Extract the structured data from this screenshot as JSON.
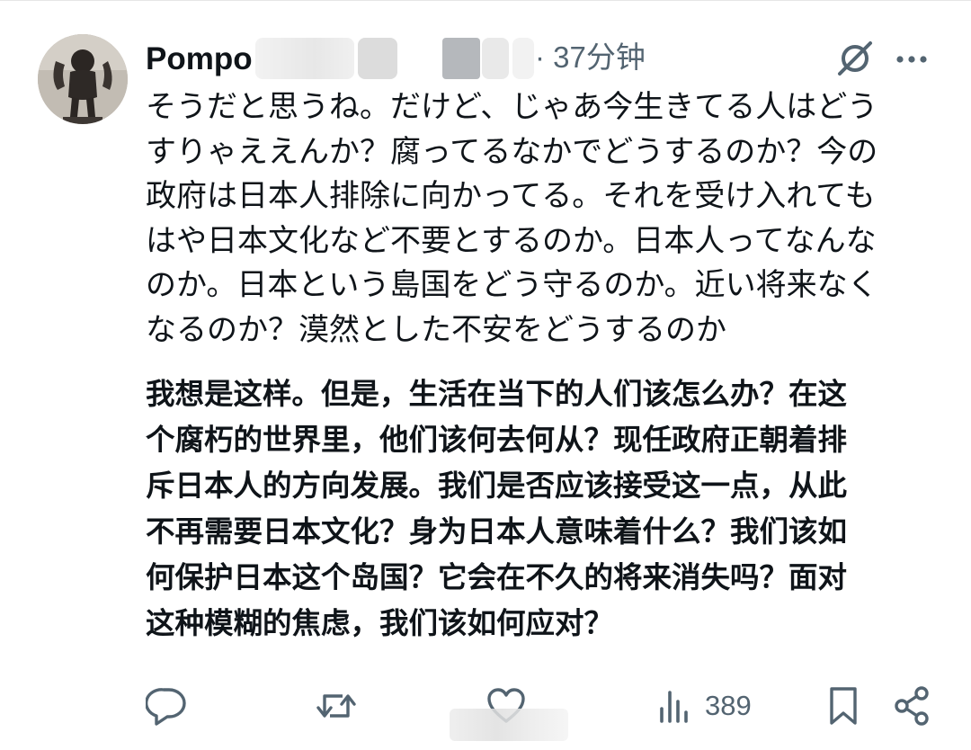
{
  "post": {
    "username": "Pompo",
    "timestamp": "· 37分钟",
    "text_lines": [
      "そうだと思うね。だけど、じゃあ今生きてる人はどう",
      "すりゃええんか？腐ってるなかでどうするのか？今の",
      "政府は日本人排除に向かってる。それを受け入れても",
      "はや日本文化など不要とするのか。日本人ってなんな",
      "のか。日本という島国をどう守るのか。近い将来なく",
      "なるのか？漠然とした不安をどうするのか"
    ],
    "translation_lines": [
      "我想是这样。但是，生活在当下的人们该怎么办？在这",
      "个腐朽的世界里，他们该何去何从？现任政府正朝着排",
      "斥日本人的方向发展。我们是否应该接受这一点，从此",
      "不再需要日本文化？身为日本人意味着什么？我们该如",
      "何保护日本这个岛国？它会在不久的将来消失吗？面对",
      "这种模糊的焦虑，我们该如何应对？"
    ]
  },
  "actions": {
    "reply_icon": "speech-bubble-icon",
    "retweet_icon": "repost-arrows-icon",
    "like_icon": "heart-icon",
    "views_icon": "bar-chart-icon",
    "views_count": "389",
    "bookmark_icon": "bookmark-icon",
    "share_icon": "share-nodes-icon"
  },
  "header_icons": {
    "grok": "grok-slash-circle-icon",
    "more": "ellipsis-icon"
  },
  "colors": {
    "text": "#0f1419",
    "muted": "#536471",
    "background": "#ffffff"
  }
}
